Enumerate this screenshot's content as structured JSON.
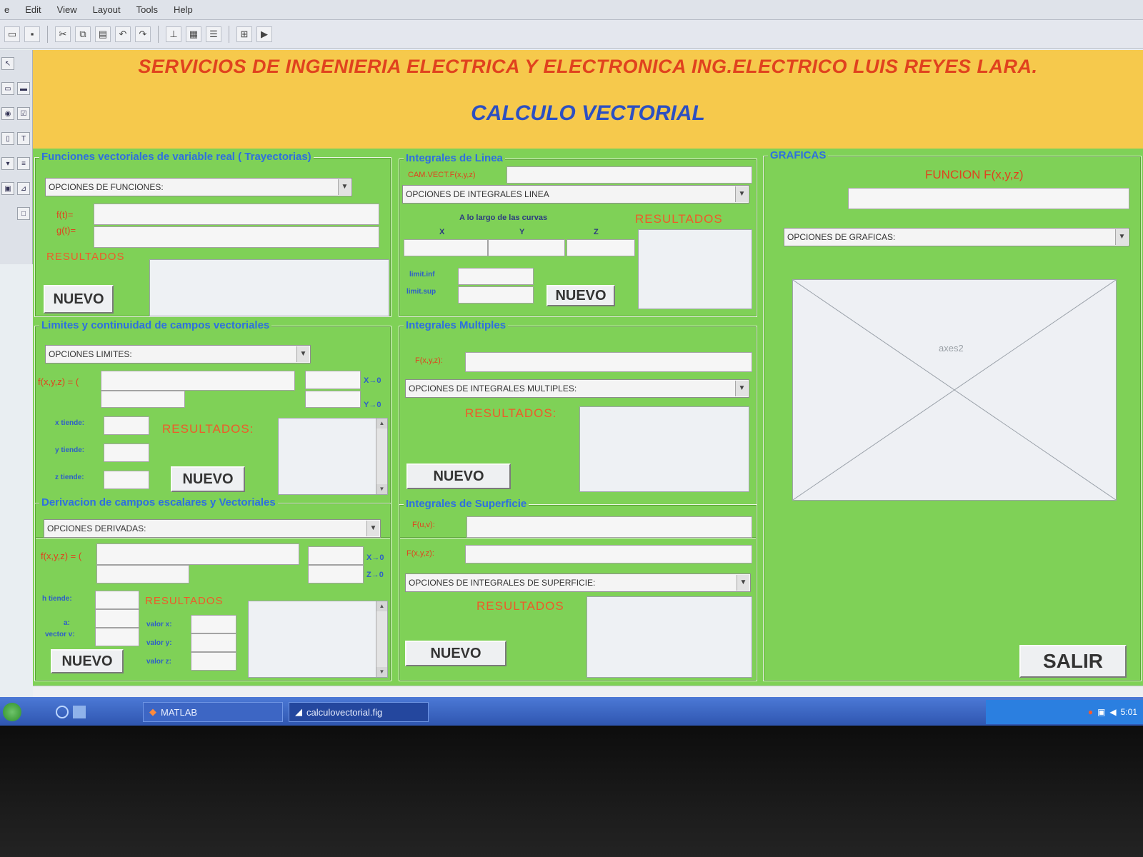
{
  "menu": [
    "e",
    "Edit",
    "View",
    "Layout",
    "Tools",
    "Help"
  ],
  "toolbar_icons": [
    "open-icon",
    "save-icon",
    "cut-icon",
    "copy-icon",
    "paste-icon",
    "undo-icon",
    "redo-icon",
    "align-icon",
    "editor-icon",
    "property-icon",
    "browser-icon",
    "run-icon"
  ],
  "header": {
    "company": "SERVICIOS DE INGENIERIA ELECTRICA Y ELECTRONICA ING.ELECTRICO LUIS REYES LARA.",
    "title": "CALCULO VECTORIAL"
  },
  "trayectorias": {
    "title": "Funciones vectoriales de variable real ( Trayectorias)",
    "dropdown": "OPCIONES DE FUNCIONES:",
    "label_ft": "f(t)=",
    "label_gt": "g(t)=",
    "results_label": "RESULTADOS",
    "new_button": "NUEVO"
  },
  "linea": {
    "title": "Integrales de Linea",
    "field_label": "CAM.VECT.F(x,y,z)",
    "dropdown": "OPCIONES DE INTEGRALES LINEA",
    "curves_label": "A lo largo de las curvas",
    "x": "X",
    "y": "Y",
    "z": "Z",
    "lim_inf": "limit.inf",
    "lim_sup": "limit.sup",
    "results_label": "RESULTADOS",
    "new_button": "NUEVO"
  },
  "limites": {
    "title": "Limites y continuidad de campos vectoriales",
    "dropdown": "OPCIONES LIMITES:",
    "func_label": "f(x,y,z) = (",
    "arrow1": "X→0",
    "arrow2": "Y→0",
    "x_tiende": "x tiende:",
    "y_tiende": "y tiende:",
    "z_tiende": "z tiende:",
    "results_label": "RESULTADOS:",
    "new_button": "NUEVO"
  },
  "multiples": {
    "title": "Integrales Multiples",
    "field_label": "F(x,y,z):",
    "dropdown": "OPCIONES DE INTEGRALES MULTIPLES:",
    "results_label": "RESULTADOS:",
    "new_button": "NUEVO"
  },
  "derivacion": {
    "title": "Derivacion de campos escalares y Vectoriales",
    "dropdown": "OPCIONES DERIVADAS:",
    "func_label": "f(x,y,z) = (",
    "arrow1": "X→0",
    "arrow2": "Z→0",
    "h_tiende": "h tiende:",
    "a_label": "a:",
    "vector_label": "vector v:",
    "valor_x": "valor x:",
    "valor_y": "valor y:",
    "valor_z": "valor z:",
    "results_label": "RESULTADOS",
    "new_button": "NUEVO"
  },
  "superficie": {
    "title": "Integrales de Superficie",
    "field1_label": "F(u,v):",
    "field2_label": "F(x,y,z):",
    "dropdown": "OPCIONES DE INTEGRALES DE SUPERFICIE:",
    "results_label": "RESULTADOS",
    "new_button": "NUEVO"
  },
  "graficas": {
    "title": "GRAFICAS",
    "func_label": "FUNCION F(x,y,z)",
    "dropdown": "OPCIONES DE GRAFICAS:",
    "axes_label": "axes2",
    "exit_button": "SALIR"
  },
  "taskbar": {
    "item1": "MATLAB",
    "item2": "calculovectorial.fig",
    "clock": "5:01"
  }
}
